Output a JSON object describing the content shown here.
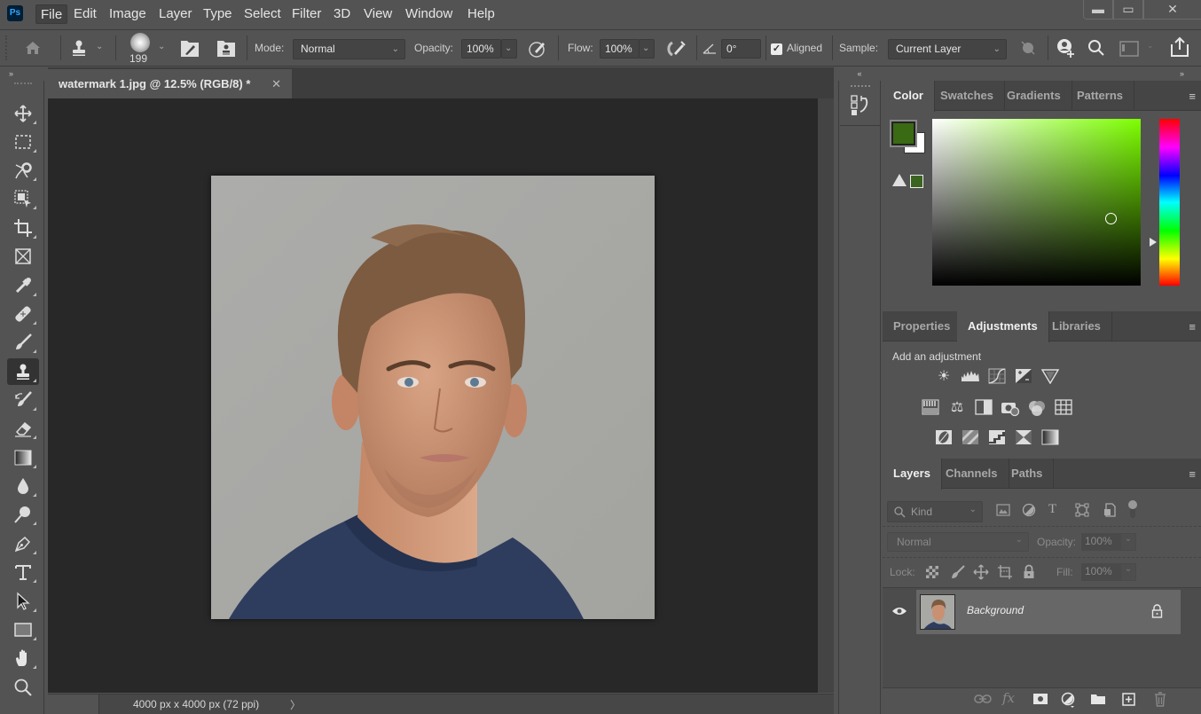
{
  "app": {
    "logo": "Ps",
    "menu": [
      "File",
      "Edit",
      "Image",
      "Layer",
      "Type",
      "Select",
      "Filter",
      "3D",
      "View",
      "Window",
      "Help"
    ],
    "active_menu": "File",
    "window_controls": {
      "minimize": "▬",
      "maximize": "▭",
      "close": "✕"
    }
  },
  "options_bar": {
    "home_icon": "home-icon",
    "tool_preset_icon": "clone-stamp-icon",
    "brush_size": "199",
    "mode_label": "Mode:",
    "mode_value": "Normal",
    "opacity_label": "Opacity:",
    "opacity_value": "100%",
    "flow_label": "Flow:",
    "flow_value": "100%",
    "angle_value": "0°",
    "aligned_label": "Aligned",
    "aligned_checked": true,
    "sample_label": "Sample:",
    "sample_value": "Current Layer"
  },
  "toolbar": {
    "tools": [
      {
        "name": "move-tool",
        "glyph": "✥"
      },
      {
        "name": "marquee-tool",
        "glyph": "⬚"
      },
      {
        "name": "lasso-tool",
        "glyph": "ↈ"
      },
      {
        "name": "object-selection-tool",
        "glyph": "⬕"
      },
      {
        "name": "crop-tool",
        "glyph": "⌗"
      },
      {
        "name": "frame-tool",
        "glyph": "⊠"
      },
      {
        "name": "eyedropper-tool",
        "glyph": "✎"
      },
      {
        "name": "healing-brush-tool",
        "glyph": "▰"
      },
      {
        "name": "brush-tool",
        "glyph": "🖌"
      },
      {
        "name": "clone-stamp-tool",
        "glyph": "⊥"
      },
      {
        "name": "history-brush-tool",
        "glyph": "↺"
      },
      {
        "name": "eraser-tool",
        "glyph": "⌫"
      },
      {
        "name": "gradient-tool",
        "glyph": "▤"
      },
      {
        "name": "blur-tool",
        "glyph": "💧"
      },
      {
        "name": "dodge-tool",
        "glyph": "⚲"
      },
      {
        "name": "pen-tool",
        "glyph": "✒"
      },
      {
        "name": "type-tool",
        "glyph": "T"
      },
      {
        "name": "path-selection-tool",
        "glyph": "➤"
      },
      {
        "name": "rectangle-tool",
        "glyph": "▭"
      },
      {
        "name": "hand-tool",
        "glyph": "✋"
      },
      {
        "name": "zoom-tool",
        "glyph": "🔍"
      }
    ],
    "active_tool": "clone-stamp-tool"
  },
  "document": {
    "tab_title": "watermark 1.jpg @ 12.5% (RGB/8) *",
    "status": "4000 px x 4000 px (72 ppi)"
  },
  "color_panel": {
    "tabs": [
      "Color",
      "Swatches",
      "Gradients",
      "Patterns"
    ],
    "active_tab": "Color",
    "foreground": "#3a6a14",
    "background": "#ffffff",
    "hue_color": "#7dff00"
  },
  "adjustments_panel": {
    "tabs": [
      "Properties",
      "Adjustments",
      "Libraries"
    ],
    "active_tab": "Adjustments",
    "heading": "Add an adjustment",
    "rows": [
      [
        "brightness-contrast",
        "levels",
        "curves",
        "exposure",
        "vibrance"
      ],
      [
        "hue-saturation",
        "color-balance",
        "black-white",
        "photo-filter",
        "channel-mixer",
        "color-lookup"
      ],
      [
        "invert",
        "posterize",
        "threshold",
        "selective-color",
        "gradient-map"
      ]
    ]
  },
  "layers_panel": {
    "tabs": [
      "Layers",
      "Channels",
      "Paths"
    ],
    "active_tab": "Layers",
    "filter_kind": "Kind",
    "blend_mode": "Normal",
    "opacity_label": "Opacity:",
    "opacity_value": "100%",
    "lock_label": "Lock:",
    "fill_label": "Fill:",
    "fill_value": "100%",
    "layers": [
      {
        "name": "Background",
        "visible": true,
        "locked": true
      }
    ]
  }
}
